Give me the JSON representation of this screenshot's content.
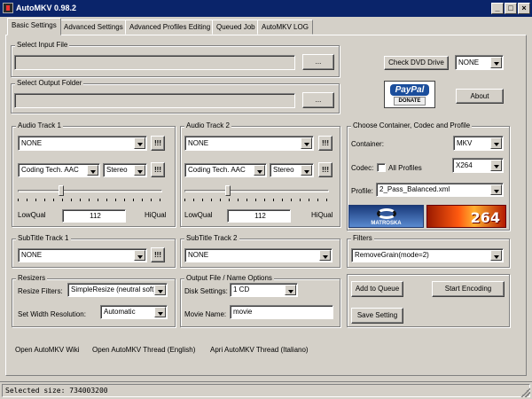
{
  "window": {
    "title": "AutoMKV 0.98.2"
  },
  "tabs": [
    {
      "label": "Basic Settings"
    },
    {
      "label": "Advanced Settings"
    },
    {
      "label": "Advanced Profiles Editing"
    },
    {
      "label": "Queued Job"
    },
    {
      "label": "AutoMKV LOG"
    }
  ],
  "input": {
    "legend": "Select Input File",
    "value": "",
    "browse_label": "..."
  },
  "output": {
    "legend": "Select Output Folder",
    "value": "",
    "browse_label": "..."
  },
  "dvd": {
    "check_label": "Check DVD Drive",
    "drive_value": "NONE"
  },
  "paypal": {
    "logo_text": "PayPal",
    "donate_text": "DONATE"
  },
  "about_label": "About",
  "audio1": {
    "legend": "Audio Track 1",
    "track": "NONE",
    "codec": "Coding Tech. AAC",
    "channels": "Stereo",
    "excl": "!!!",
    "quality": "112",
    "low": "LowQual",
    "high": "HiQual",
    "level": 0.3
  },
  "audio2": {
    "legend": "Audio Track 2",
    "track": "NONE",
    "codec": "Coding Tech. AAC",
    "channels": "Stereo",
    "excl": "!!!",
    "quality": "112",
    "low": "LowQual",
    "high": "HiQual",
    "level": 0.3
  },
  "profile": {
    "legend": "Choose Container, Codec and Profile",
    "container_label": "Container:",
    "container_value": "MKV",
    "codec_label": "Codec:",
    "all_profiles_label": "All Profiles",
    "codec_value": "X264",
    "profile_label": "Profile:",
    "profile_value": "2_Pass_Balanced.xml"
  },
  "logos": {
    "matroska_text": "MATROSKA",
    "x264_text": "264"
  },
  "subtitle1": {
    "legend": "SubTitle Track 1",
    "value": "NONE",
    "excl": "!!!"
  },
  "subtitle2": {
    "legend": "SubTitle Track 2",
    "value": "NONE"
  },
  "filters": {
    "legend": "Filters",
    "value": "RemoveGrain(mode=2)"
  },
  "resizers": {
    "legend": "Resizers",
    "filter_label": "Resize Filters:",
    "filter_value": "SimpleResize (neutral soft)",
    "width_label": "Set Width Resolution:",
    "width_value": "Automatic"
  },
  "outopts": {
    "legend": "Output File / Name Options",
    "disk_label": "Disk Settings:",
    "disk_value": "1 CD",
    "movie_label": "Movie Name:",
    "movie_value": "movie"
  },
  "actions": {
    "add_queue": "Add to Queue",
    "start": "Start Encoding",
    "save": "Save Setting"
  },
  "links": {
    "wiki": "Open AutoMKV Wiki",
    "thread_en": "Open AutoMKV Thread (English)",
    "thread_it": "Apri AutoMKV Thread (Italiano)"
  },
  "status": {
    "text": "Selected size: 734003200"
  }
}
